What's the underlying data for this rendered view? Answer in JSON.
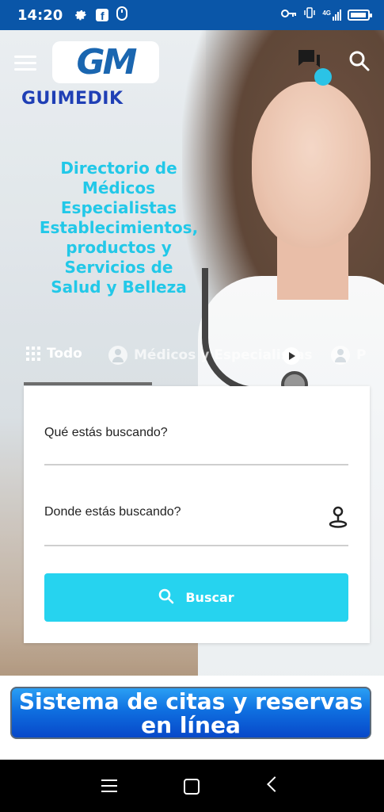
{
  "status_bar": {
    "time": "14:20",
    "network": "4G"
  },
  "header": {
    "brand_logo": "GM",
    "brand_name": "GUIMEDIK"
  },
  "hero": {
    "tagline_lines": [
      "Directorio de",
      "Médicos",
      "Especialistas",
      "Establecimientos,",
      "productos y",
      "Servicios de",
      "Salud y Belleza"
    ]
  },
  "tabs": [
    {
      "label": "Todo",
      "icon": "grid-icon"
    },
    {
      "label": "Médicos y Especialistas",
      "icon": "person-icon"
    },
    {
      "label": "P",
      "icon": "person-icon"
    }
  ],
  "search": {
    "what_placeholder": "Qué estás buscando?",
    "where_placeholder": "Donde estás buscando?",
    "button_label": "Buscar"
  },
  "banner": {
    "text": "Sistema de citas y reservas en línea"
  },
  "colors": {
    "status_bar": "#0a56a8",
    "accent": "#26d3ef",
    "brand": "#1f3fb5"
  }
}
